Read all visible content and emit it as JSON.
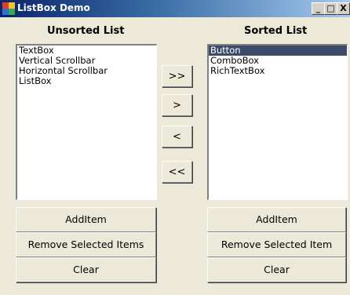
{
  "window": {
    "title": "ListBox Demo",
    "minimize": "_",
    "maximize": "□",
    "close": "X",
    "icon": "app-window-icon"
  },
  "left": {
    "heading": "Unsorted List",
    "items": [
      "TextBox",
      "Vertical Scrollbar",
      "Horizontal Scrollbar",
      "ListBox"
    ],
    "buttons": {
      "add": "AddItem",
      "remove": "Remove Selected Items",
      "clear": "Clear"
    }
  },
  "right": {
    "heading": "Sorted List",
    "items": [
      "Button",
      "ComboBox",
      "RichTextBox"
    ],
    "selected_item": "Button",
    "buttons": {
      "add": "AddItem",
      "remove": "Remove Selected Item",
      "clear": "Clear"
    }
  },
  "transfer": {
    "move_all_right": ">>",
    "move_right": ">",
    "move_left": "<",
    "move_all_left": "<<"
  },
  "colors": {
    "selection": "#3d4b6b",
    "titlebar_start": "#0a246a",
    "titlebar_end": "#a6caf0",
    "face": "#ece9d8"
  }
}
